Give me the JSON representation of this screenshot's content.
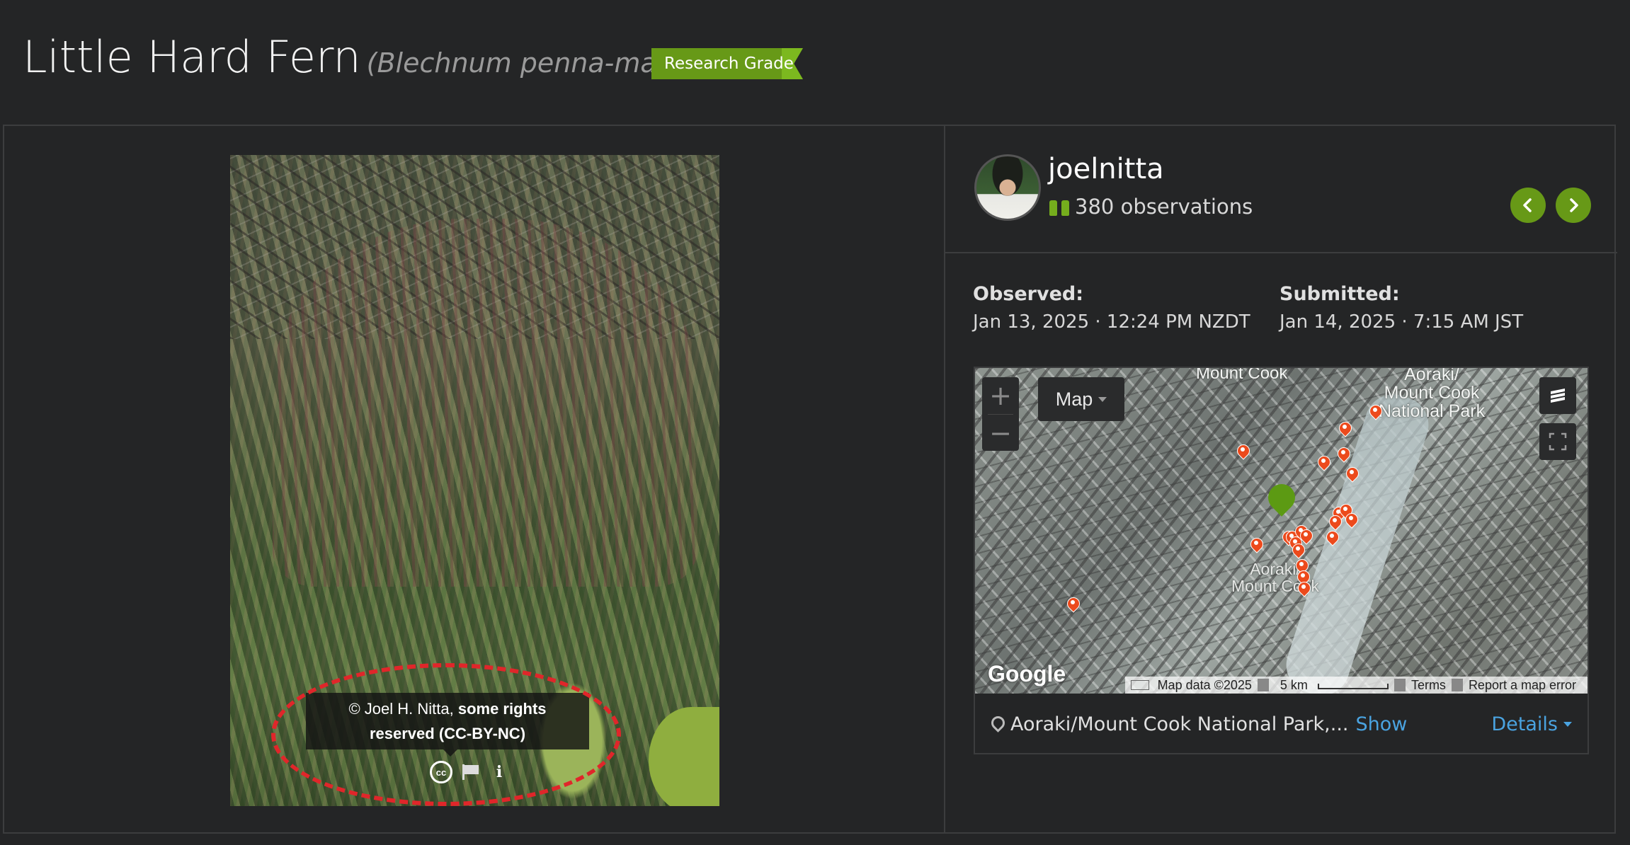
{
  "header": {
    "common_name": "Little Hard Fern",
    "scientific_name": "(Blechnum penna-marina)",
    "quality_grade": "Research Grade"
  },
  "photo": {
    "attribution_prefix": "© Joel H. Nitta, ",
    "attribution_rights_1": "some rights",
    "attribution_rights_2": "reserved (CC-BY-NC)",
    "license_icon_text": "cc",
    "info_icon_text": "i",
    "annotation_color": "#e0262a"
  },
  "observer": {
    "username": "joelnitta",
    "observation_count": "380 observations"
  },
  "dates": {
    "observed_label": "Observed:",
    "observed_value": "Jan 13, 2025 · 12:24 PM NZDT",
    "submitted_label": "Submitted:",
    "submitted_value": "Jan 14, 2025 · 7:15 AM JST"
  },
  "map": {
    "zoom_in": "+",
    "zoom_out": "−",
    "map_type": "Map",
    "label_top": "Mount Cook",
    "label_park_1": "Aoraki/",
    "label_park_2": "Mount Cook",
    "label_park_3": "National Park",
    "label_aoraki_1": "Aoraki/",
    "label_aoraki_2": "Mount Cook",
    "google_logo": "Google",
    "footer_map_data": "Map data ©2025",
    "footer_scale": "5 km",
    "footer_terms": "Terms",
    "footer_report": "Report a map error",
    "accent_pin_color": "#ec4a1c",
    "observation_pin_color": "#5c9a13"
  },
  "location": {
    "place": "Aoraki/Mount Cook National Park,...",
    "show_link": "Show",
    "details_link": "Details"
  },
  "colors": {
    "brand_green": "#679917",
    "link_blue": "#4aa3e0",
    "background": "#242526"
  }
}
